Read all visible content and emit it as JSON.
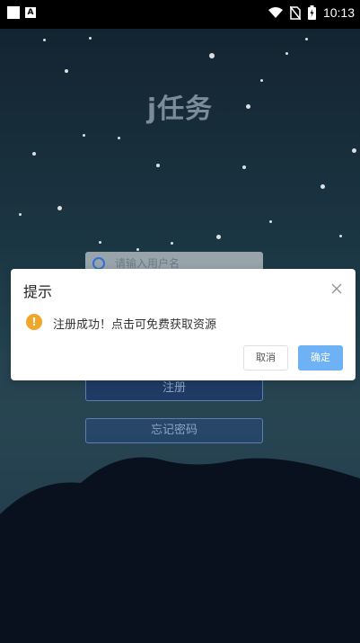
{
  "status_bar": {
    "time": "10:13",
    "icons": [
      "square-icon",
      "a-badge-icon",
      "wifi-icon",
      "no-sim-icon",
      "battery-icon"
    ]
  },
  "app": {
    "title": "j任务"
  },
  "login_form": {
    "username_placeholder": "请输入用户名",
    "register_label": "注册",
    "forgot_password_label": "忘记密码"
  },
  "dialog": {
    "title": "提示",
    "message": "注册成功！点击可免费获取资源",
    "cancel_label": "取消",
    "confirm_label": "确定",
    "icons": [
      "close-icon",
      "warning-icon"
    ]
  },
  "colors": {
    "confirm": "#6fb1f5",
    "warning": "#f0a52b",
    "accent_blue": "#3170d6"
  }
}
